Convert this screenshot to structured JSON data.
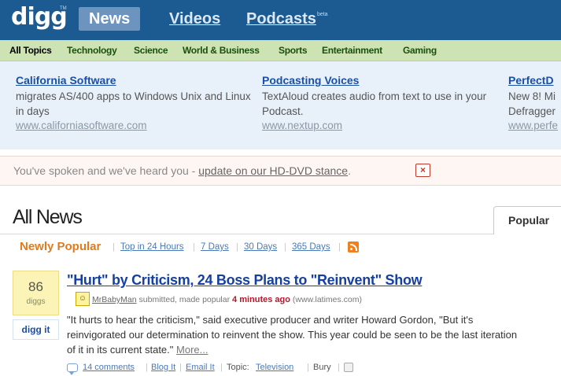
{
  "header": {
    "logo": "digg",
    "logo_tm": "TM",
    "nav": [
      {
        "label": "News"
      },
      {
        "label": "Videos"
      },
      {
        "label": "Podcasts"
      }
    ],
    "beta": "beta"
  },
  "topics": [
    "All Topics",
    "Technology",
    "Science",
    "World & Business",
    "Sports",
    "Entertainment",
    "Gaming"
  ],
  "ads": [
    {
      "title": "California Software",
      "body": "migrates AS/400 apps to Windows Unix and Linux in days",
      "url": "www.californiasoftware.com"
    },
    {
      "title": "Podcasting Voices",
      "body": "TextAloud creates audio from text to use in your Podcast.",
      "url": "www.nextup.com"
    },
    {
      "title": "PerfectD",
      "body": "New 8! Mi Defragger",
      "url": "www.perfe"
    }
  ],
  "notice": {
    "text": "You've spoken and we've heard you - ",
    "link": "update on our HD-DVD stance",
    "end": ".",
    "close": "×"
  },
  "main": {
    "title": "All News",
    "popular_tab": "Popular",
    "subnav": {
      "current": "Newly Popular",
      "links": [
        "Top in 24 Hours",
        "7 Days",
        "30 Days",
        "365 Days"
      ]
    }
  },
  "story": {
    "diggs": "86",
    "diggs_label": "diggs",
    "digg_it": "digg it",
    "title": "\"Hurt\" by Criticism, 24 Boss Plans to \"Reinvent\" Show",
    "user": "MrBabyMan",
    "meta_mid": " submitted, made popular ",
    "time": "4 minutes ago",
    "domain": " (www.latimes.com)",
    "body": "\"It hurts to hear the criticism,\" said executive producer and writer Howard Gordon, \"But it's reinvigorated our determination to reinvent the show. This year could be seen to be the last iteration of it in its current state.\" ",
    "more": "More...",
    "comments": "14 comments",
    "blog": "Blog It",
    "email": "Email It",
    "topic_label": "Topic:",
    "topic": "Television",
    "bury": "Bury"
  },
  "colors": {
    "header_bg": "#1c5a92",
    "topics_bg": "#cde3b3",
    "ads_bg": "#e8f1f9",
    "accent_orange": "#e07b1c",
    "link_blue": "#1540a0",
    "digg_box": "#fcf4b6"
  },
  "icons": [
    "close-icon",
    "rss-icon",
    "user-avatar-icon",
    "comment-icon",
    "bury-icon"
  ]
}
